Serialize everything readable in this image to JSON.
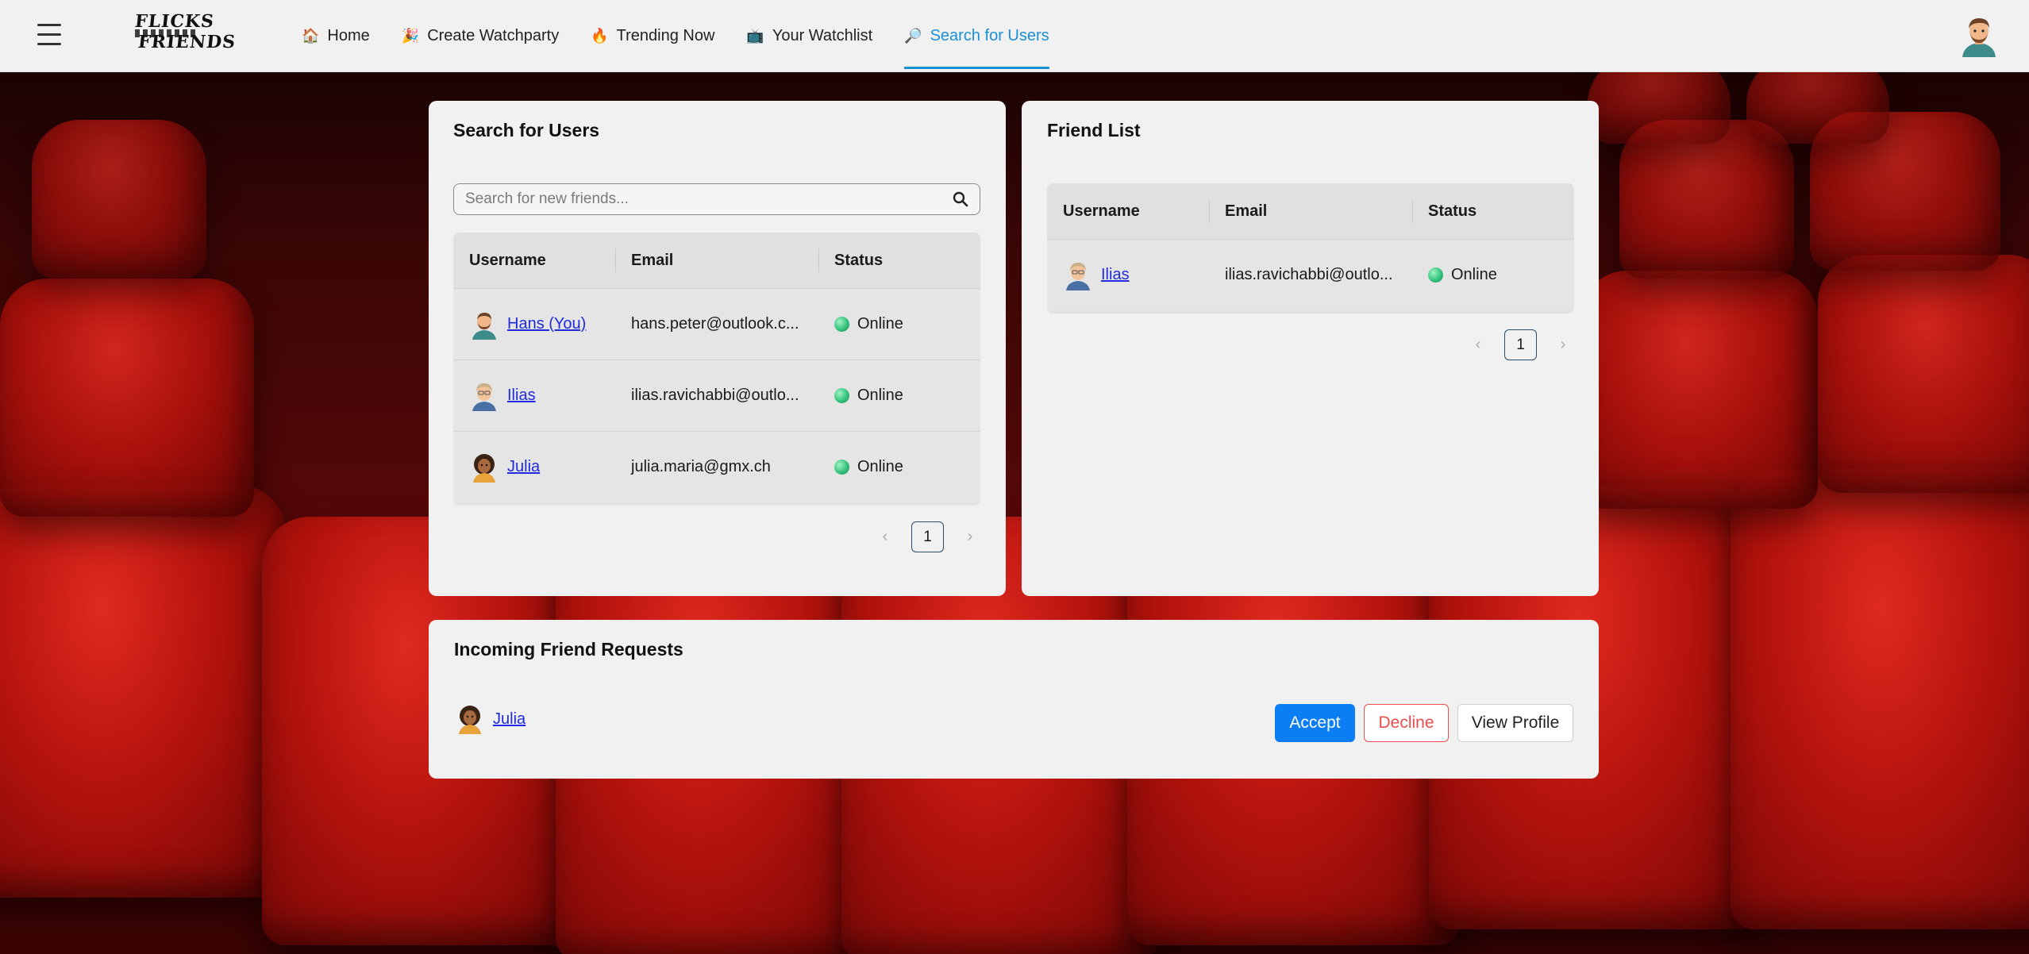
{
  "nav": {
    "logo_line1": "FLICKS",
    "logo_line2": "FRIENDS",
    "items": [
      {
        "icon": "🏠",
        "label": "Home"
      },
      {
        "icon": "🎉",
        "label": "Create Watchparty"
      },
      {
        "icon": "🔥",
        "label": "Trending Now"
      },
      {
        "icon": "📺",
        "label": "Your Watchlist"
      },
      {
        "icon": "🔎",
        "label": "Search for Users"
      }
    ],
    "active": "Search for Users"
  },
  "search_card": {
    "title": "Search for Users",
    "search_placeholder": "Search for new friends...",
    "headers": [
      "Username",
      "Email",
      "Status"
    ],
    "rows": [
      {
        "username": "Hans (You)",
        "email": "hans.peter@outlook.c...",
        "status": "Online"
      },
      {
        "username": "Ilias",
        "email": "ilias.ravichabbi@outlo...",
        "status": "Online"
      },
      {
        "username": "Julia",
        "email": "julia.maria@gmx.ch",
        "status": "Online"
      }
    ],
    "page": "1"
  },
  "friend_card": {
    "title": "Friend List",
    "headers": [
      "Username",
      "Email",
      "Status"
    ],
    "rows": [
      {
        "username": "Ilias",
        "email": "ilias.ravichabbi@outlo...",
        "status": "Online"
      }
    ],
    "page": "1"
  },
  "requests_card": {
    "title": "Incoming Friend Requests",
    "requester": "Julia",
    "accept": "Accept",
    "decline": "Decline",
    "view_profile": "View Profile"
  },
  "colors": {
    "accent": "#1a8fd6",
    "primary_button": "#0a7ef2",
    "decline": "#ef4d4d",
    "online": "#34c27b",
    "link": "#1f2bdc"
  }
}
